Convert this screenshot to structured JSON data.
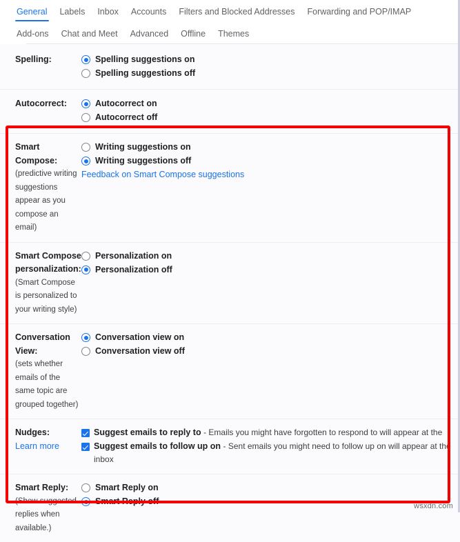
{
  "tabs": {
    "row1": [
      {
        "label": "General",
        "active": true
      },
      {
        "label": "Labels",
        "active": false
      },
      {
        "label": "Inbox",
        "active": false
      },
      {
        "label": "Accounts",
        "active": false
      },
      {
        "label": "Filters and Blocked Addresses",
        "active": false
      },
      {
        "label": "Forwarding and POP/IMAP",
        "active": false
      }
    ],
    "row2": [
      {
        "label": "Add-ons",
        "active": false
      },
      {
        "label": "Chat and Meet",
        "active": false
      },
      {
        "label": "Advanced",
        "active": false
      },
      {
        "label": "Offline",
        "active": false
      },
      {
        "label": "Themes",
        "active": false
      }
    ]
  },
  "settings": {
    "spelling": {
      "label": "Spelling:",
      "option_on": "Spelling suggestions on",
      "option_off": "Spelling suggestions off",
      "selected": "on"
    },
    "autocorrect": {
      "label": "Autocorrect:",
      "option_on": "Autocorrect on",
      "option_off": "Autocorrect off",
      "selected": "on"
    },
    "smart_compose": {
      "label": "Smart Compose:",
      "note": "(predictive writing suggestions appear as you compose an email)",
      "option_on": "Writing suggestions on",
      "option_off": "Writing suggestions off",
      "selected": "off",
      "feedback_link": "Feedback on Smart Compose suggestions"
    },
    "smart_compose_personalization": {
      "label": "Smart Compose personalization:",
      "note": "(Smart Compose is personalized to your writing style)",
      "option_on": "Personalization on",
      "option_off": "Personalization off",
      "selected": "off"
    },
    "conversation_view": {
      "label": "Conversation View:",
      "note": "(sets whether emails of the same topic are grouped together)",
      "option_on": "Conversation view on",
      "option_off": "Conversation view off",
      "selected": "on"
    },
    "nudges": {
      "label": "Nudges:",
      "learn_more": "Learn more",
      "reply_label": "Suggest emails to reply to",
      "reply_desc": "- Emails you might have forgotten to respond to will appear at the",
      "followup_label": "Suggest emails to follow up on",
      "followup_desc": "- Sent emails you might need to follow up on will appear at the",
      "followup_desc2": "inbox",
      "reply_checked": true,
      "followup_checked": true
    },
    "smart_reply": {
      "label": "Smart Reply:",
      "note": "(Show suggested replies when available.)",
      "option_on": "Smart Reply on",
      "option_off": "Smart Reply off",
      "selected": "off"
    }
  },
  "annotation": {
    "highlight_color": "#f50000"
  },
  "watermark": "wsxdn.com"
}
